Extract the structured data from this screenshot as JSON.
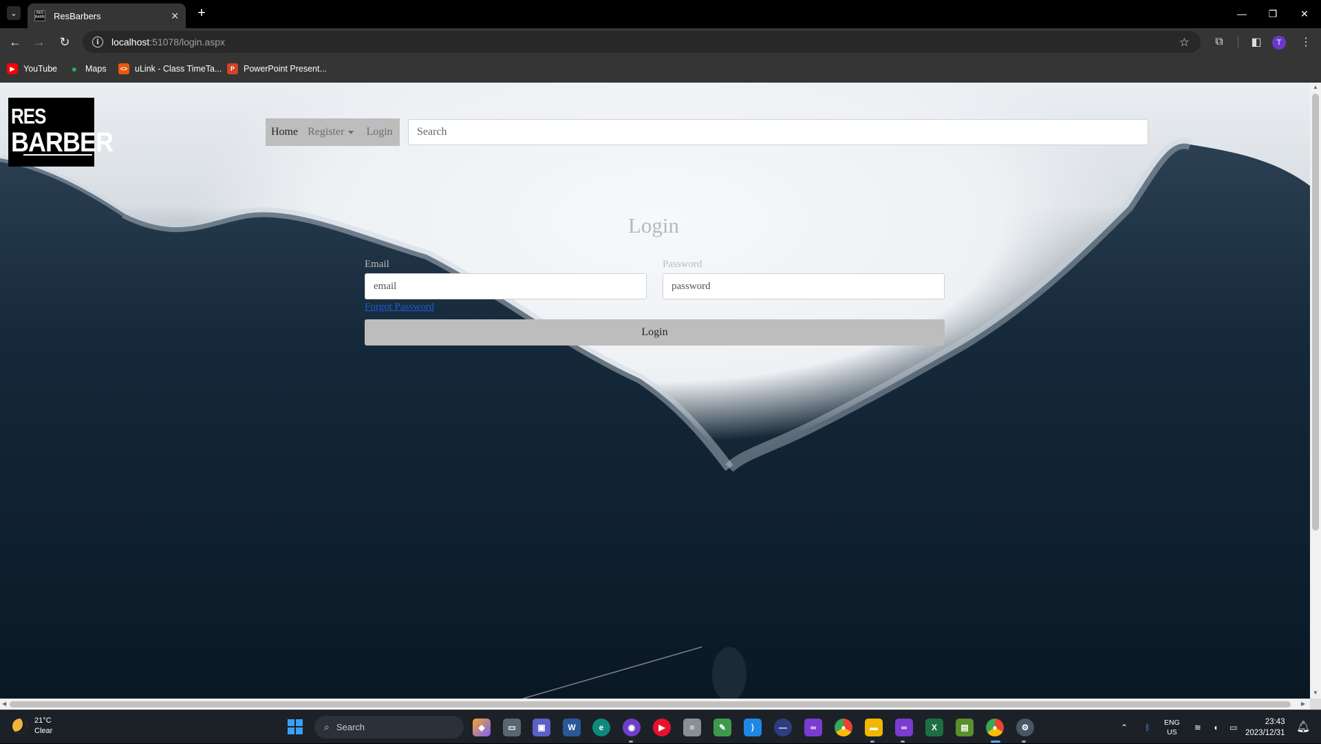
{
  "browser": {
    "tab_title": "ResBarbers",
    "favicon_text": "RES BARBER",
    "url_host": "localhost",
    "url_path": ":51078/login.aspx",
    "bookmarks": [
      {
        "label": "YouTube",
        "icon": "youtube-icon",
        "color": "#ff0000"
      },
      {
        "label": "Maps",
        "icon": "maps-pin-icon",
        "color": "#34a853"
      },
      {
        "label": "uLink - Class TimeTa...",
        "icon": "ulink-icon",
        "color": "#e8590c"
      },
      {
        "label": "PowerPoint Present...",
        "icon": "powerpoint-icon",
        "color": "#d04423"
      }
    ],
    "avatar_letter": "T"
  },
  "site": {
    "logo_line1": "RES",
    "logo_line2": "BARBER",
    "nav": {
      "home": "Home",
      "register": "Register",
      "login": "Login"
    },
    "search_placeholder": "Search"
  },
  "login_form": {
    "heading": "Login",
    "email_label": "Email",
    "email_placeholder": "email",
    "password_label": "Password",
    "password_placeholder": "password",
    "forgot_link": "Forgot Password",
    "submit_label": "Login"
  },
  "taskbar": {
    "weather_temp": "21°C",
    "weather_desc": "Clear",
    "search_label": "Search",
    "lang_line1": "ENG",
    "lang_line2": "US",
    "time": "23:43",
    "date": "2023/12/31"
  },
  "colors": {
    "accent": "#1a5bd6",
    "nav_bg": "#bdbdbd",
    "page_dark": "#0e1e2b"
  }
}
